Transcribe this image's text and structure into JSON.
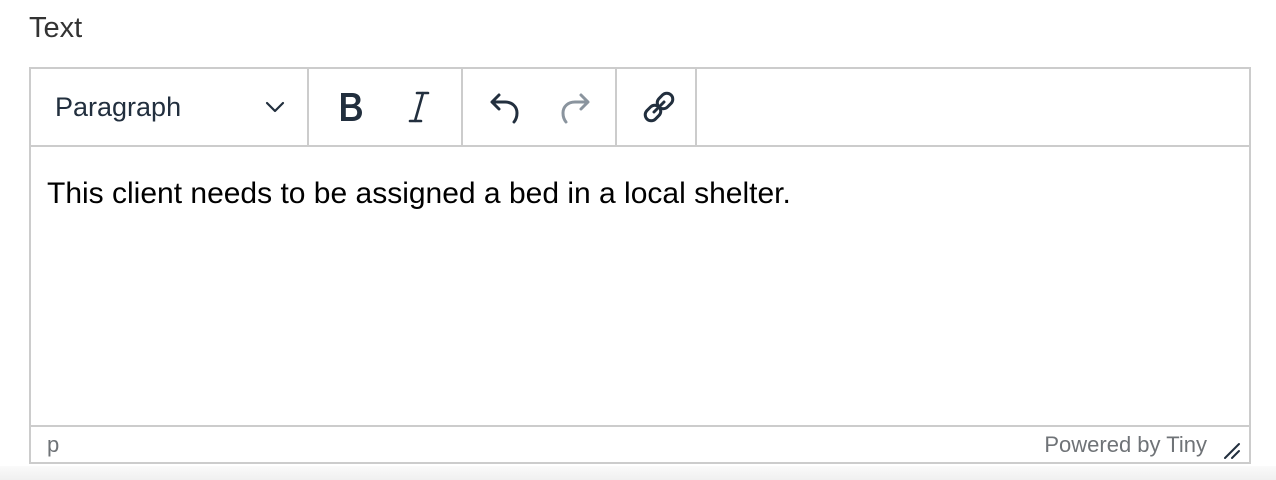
{
  "field": {
    "label": "Text"
  },
  "toolbar": {
    "block_format": "Paragraph",
    "buttons": {
      "bold": "bold-icon",
      "italic": "italic-icon",
      "undo": "undo-icon",
      "redo": "redo-icon",
      "link": "link-icon"
    },
    "redo_disabled": true
  },
  "editor": {
    "content": "This client needs to be assigned a bed in a local shelter."
  },
  "statusbar": {
    "path": "p",
    "branding": "Powered by Tiny"
  },
  "colors": {
    "icon": "#222f3e",
    "icon_disabled": "#8a949e",
    "border": "#cccccc",
    "status_text": "#6f7377"
  }
}
